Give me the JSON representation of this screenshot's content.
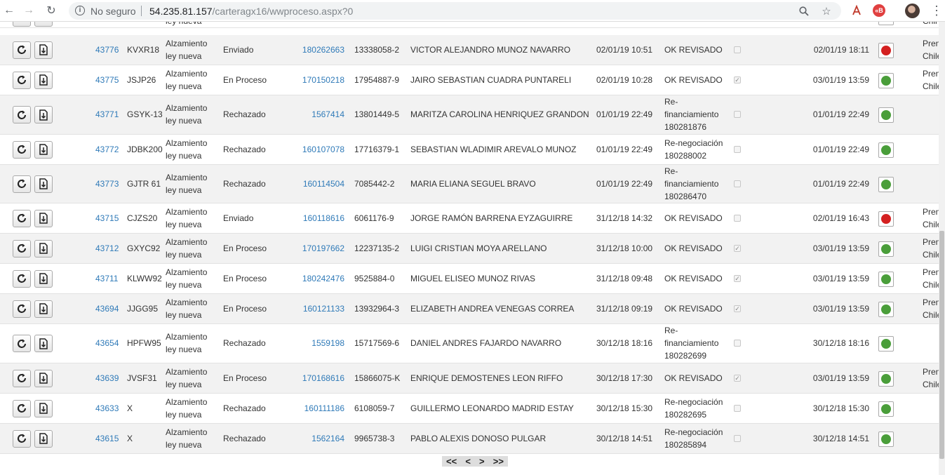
{
  "browser": {
    "secure_label": "No seguro",
    "url_host": "54.235.81.157",
    "url_path": "/carteragx16/wwproceso.aspx?0"
  },
  "colors": {
    "link": "#2f7ab8",
    "green": "#4a9e3a",
    "red": "#d42020",
    "stripe": "#f2f2f2"
  },
  "partial_row": {
    "detalle": "ley nueva",
    "extra": "Chil"
  },
  "rows": [
    {
      "id": "43776",
      "patente": "KVXR18",
      "tipo1": "Alzamiento",
      "tipo2": "ley nueva",
      "estado": "Enviado",
      "op": "180262663",
      "rut": "13338058-2",
      "nombre": "VICTOR ALEJANDRO MUNOZ NAVARRO",
      "fecha": "02/01/19 10:51",
      "obs": [
        "OK REVISADO"
      ],
      "checked": false,
      "fecha2": "02/01/19 18:11",
      "status": "red",
      "extra": [
        "Pren",
        "Chile"
      ]
    },
    {
      "id": "43775",
      "patente": "JSJP26",
      "tipo1": "Alzamiento",
      "tipo2": "ley nueva",
      "estado": "En Proceso",
      "op": "170150218",
      "rut": "17954887-9",
      "nombre": "JAIRO SEBASTIAN CUADRA PUNTARELI",
      "fecha": "02/01/19 10:28",
      "obs": [
        "OK REVISADO"
      ],
      "checked": true,
      "fecha2": "03/01/19 13:59",
      "status": "green",
      "extra": [
        "Pren",
        "Chile"
      ]
    },
    {
      "id": "43771",
      "patente": "GSYK-13",
      "tipo1": "Alzamiento",
      "tipo2": "ley nueva",
      "estado": "Rechazado",
      "op": "1567414",
      "rut": "13801449-5",
      "nombre": "MARITZA CAROLINA HENRIQUEZ GRANDON",
      "fecha": "01/01/19 22:49",
      "obs": [
        "Re-",
        "financiamiento",
        "180281876"
      ],
      "checked": false,
      "fecha2": "01/01/19 22:49",
      "status": "green",
      "extra": []
    },
    {
      "id": "43772",
      "patente": "JDBK200",
      "tipo1": "Alzamiento",
      "tipo2": "ley nueva",
      "estado": "Rechazado",
      "op": "160107078",
      "rut": "17716379-1",
      "nombre": "SEBASTIAN WLADIMIR AREVALO MUNOZ",
      "fecha": "01/01/19 22:49",
      "obs": [
        "Re-negociación",
        "180288002"
      ],
      "checked": false,
      "fecha2": "01/01/19 22:49",
      "status": "green",
      "extra": []
    },
    {
      "id": "43773",
      "patente": "GJTR 61",
      "tipo1": "Alzamiento",
      "tipo2": "ley nueva",
      "estado": "Rechazado",
      "op": "160114504",
      "rut": "7085442-2",
      "nombre": "MARIA ELIANA SEGUEL BRAVO",
      "fecha": "01/01/19 22:49",
      "obs": [
        "Re-",
        "financiamiento",
        "180286470"
      ],
      "checked": false,
      "fecha2": "01/01/19 22:49",
      "status": "green",
      "extra": []
    },
    {
      "id": "43715",
      "patente": "CJZS20",
      "tipo1": "Alzamiento",
      "tipo2": "ley nueva",
      "estado": "Enviado",
      "op": "160118616",
      "rut": "6061176-9",
      "nombre": "JORGE RAMÓN BARRENA EYZAGUIRRE",
      "fecha": "31/12/18 14:32",
      "obs": [
        "OK REVISADO"
      ],
      "checked": false,
      "fecha2": "02/01/19 16:43",
      "status": "red",
      "extra": [
        "Pren",
        "Chile"
      ]
    },
    {
      "id": "43712",
      "patente": "GXYC92",
      "tipo1": "Alzamiento",
      "tipo2": "ley nueva",
      "estado": "En Proceso",
      "op": "170197662",
      "rut": "12237135-2",
      "nombre": "LUIGI CRISTIAN MOYA ARELLANO",
      "fecha": "31/12/18 10:00",
      "obs": [
        "OK REVISADO"
      ],
      "checked": true,
      "fecha2": "03/01/19 13:59",
      "status": "green",
      "extra": [
        "Pren",
        "Chile"
      ]
    },
    {
      "id": "43711",
      "patente": "KLWW92",
      "tipo1": "Alzamiento",
      "tipo2": "ley nueva",
      "estado": "En Proceso",
      "op": "180242476",
      "rut": "9525884-0",
      "nombre": "MIGUEL ELISEO MUNOZ RIVAS",
      "fecha": "31/12/18 09:48",
      "obs": [
        "OK REVISADO"
      ],
      "checked": true,
      "fecha2": "03/01/19 13:59",
      "status": "green",
      "extra": [
        "Pren",
        "Chile"
      ]
    },
    {
      "id": "43694",
      "patente": "JJGG95",
      "tipo1": "Alzamiento",
      "tipo2": "ley nueva",
      "estado": "En Proceso",
      "op": "160121133",
      "rut": "13932964-3",
      "nombre": "ELIZABETH ANDREA VENEGAS CORREA",
      "fecha": "31/12/18 09:19",
      "obs": [
        "OK REVISADO"
      ],
      "checked": true,
      "fecha2": "03/01/19 13:59",
      "status": "green",
      "extra": [
        "Pren",
        "Chile"
      ]
    },
    {
      "id": "43654",
      "patente": "HPFW95",
      "tipo1": "Alzamiento",
      "tipo2": "ley nueva",
      "estado": "Rechazado",
      "op": "1559198",
      "rut": "15717569-6",
      "nombre": "DANIEL ANDRES FAJARDO NAVARRO",
      "fecha": "30/12/18 18:16",
      "obs": [
        "Re-",
        "financiamiento",
        "180282699"
      ],
      "checked": false,
      "fecha2": "30/12/18 18:16",
      "status": "green",
      "extra": []
    },
    {
      "id": "43639",
      "patente": "JVSF31",
      "tipo1": "Alzamiento",
      "tipo2": "ley nueva",
      "estado": "En Proceso",
      "op": "170168616",
      "rut": "15866075-K",
      "nombre": "ENRIQUE DEMOSTENES LEON RIFFO",
      "fecha": "30/12/18 17:30",
      "obs": [
        "OK REVISADO"
      ],
      "checked": true,
      "fecha2": "03/01/19 13:59",
      "status": "green",
      "extra": [
        "Pren",
        "Chile"
      ]
    },
    {
      "id": "43633",
      "patente": "X",
      "tipo1": "Alzamiento",
      "tipo2": "ley nueva",
      "estado": "Rechazado",
      "op": "160111186",
      "rut": "6108059-7",
      "nombre": "GUILLERMO LEONARDO MADRID ESTAY",
      "fecha": "30/12/18 15:30",
      "obs": [
        "Re-negociación",
        "180282695"
      ],
      "checked": false,
      "fecha2": "30/12/18 15:30",
      "status": "green",
      "extra": []
    },
    {
      "id": "43615",
      "patente": "X",
      "tipo1": "Alzamiento",
      "tipo2": "ley nueva",
      "estado": "Rechazado",
      "op": "1562164",
      "rut": "9965738-3",
      "nombre": "PABLO ALEXIS DONOSO PULGAR",
      "fecha": "30/12/18 14:51",
      "obs": [
        "Re-negociación",
        "180285894"
      ],
      "checked": false,
      "fecha2": "30/12/18 14:51",
      "status": "green",
      "extra": []
    }
  ],
  "pager": {
    "first": "<<",
    "prev": "<",
    "next": ">",
    "last": ">>"
  }
}
